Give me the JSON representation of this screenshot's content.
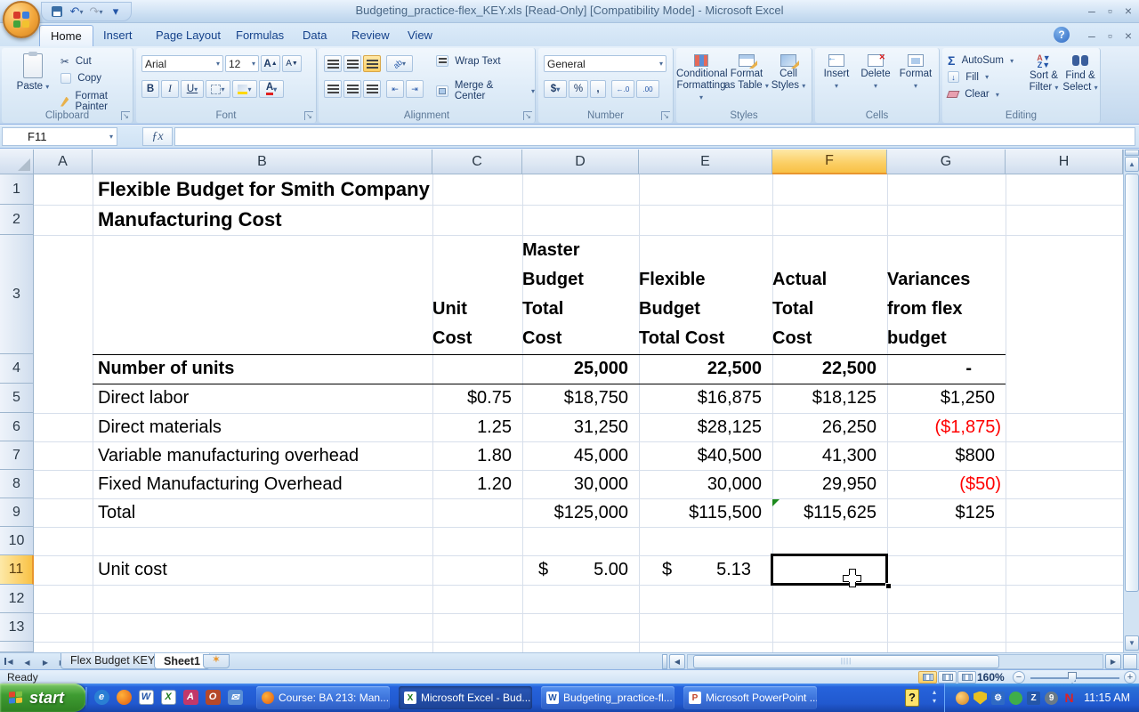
{
  "window": {
    "title": "Budgeting_practice-flex_KEY.xls  [Read-Only]  [Compatibility Mode] -  Microsoft Excel",
    "minimize": "–",
    "restore": "▫",
    "close": "×",
    "help": "?"
  },
  "ribbon": {
    "tabs": [
      {
        "label": "Home"
      },
      {
        "label": "Insert"
      },
      {
        "label": "Page Layout"
      },
      {
        "label": "Formulas"
      },
      {
        "label": "Data"
      },
      {
        "label": "Review"
      },
      {
        "label": "View"
      }
    ],
    "clipboard": {
      "label": "Clipboard",
      "paste": "Paste",
      "cut": "Cut",
      "copy": "Copy",
      "format_painter": "Format Painter"
    },
    "font": {
      "label": "Font",
      "name": "Arial",
      "size": "12",
      "bold": "B",
      "italic": "I",
      "underline": "U",
      "grow": "A",
      "shrink": "A"
    },
    "alignment": {
      "label": "Alignment",
      "wrap": "Wrap Text",
      "merge": "Merge & Center"
    },
    "number": {
      "label": "Number",
      "format": "General",
      "currency": "$",
      "percent": "%",
      "comma": ",",
      "inc_dec": "←.0",
      "dec_dec": ".00"
    },
    "styles": {
      "label": "Styles",
      "conditional1": "Conditional",
      "conditional2": "Formatting",
      "as_table1": "Format",
      "as_table2": "as Table",
      "cell1": "Cell",
      "cell2": "Styles"
    },
    "cells": {
      "label": "Cells",
      "insert": "Insert",
      "delete": "Delete",
      "format": "Format"
    },
    "editing": {
      "label": "Editing",
      "autosum": "AutoSum",
      "fill": "Fill",
      "clear": "Clear",
      "sort1": "Sort &",
      "sort2": "Filter",
      "find1": "Find &",
      "find2": "Select"
    }
  },
  "formula_bar": {
    "name_box": "F11",
    "fx": "ƒx",
    "formula": ""
  },
  "grid": {
    "columns": [
      "A",
      "B",
      "C",
      "D",
      "E",
      "F",
      "G",
      "H"
    ],
    "rows": [
      "1",
      "2",
      "3",
      "4",
      "5",
      "6",
      "7",
      "8",
      "9",
      "10",
      "11",
      "12",
      "13"
    ],
    "selected_cell": "F11"
  },
  "sheet": {
    "title_line1": "Flexible Budget for Smith Company",
    "title_line2": "Manufacturing Cost",
    "col_headers": {
      "unit_cost": "Unit\nCost",
      "master_budget": "Master\nBudget\nTotal\nCost",
      "flexible_budget": "Flexible\nBudget\nTotal Cost",
      "actual": "Actual\nTotal\nCost",
      "variances": "Variances\nfrom flex\nbudget"
    },
    "rows": [
      {
        "label": "Number of units",
        "d": "25,000",
        "e": "22,500",
        "f": "22,500",
        "g": "-"
      },
      {
        "label": "Direct labor",
        "c": "$0.75",
        "d": "$18,750",
        "e": "$16,875",
        "f": "$18,125",
        "g": "$1,250"
      },
      {
        "label": "Direct materials",
        "c": "1.25",
        "d": "31,250",
        "e": "$28,125",
        "f": "26,250",
        "g": "($1,875)"
      },
      {
        "label": "Variable manufacturing overhead",
        "c": "1.80",
        "d": "45,000",
        "e": "$40,500",
        "f": "41,300",
        "g": "$800"
      },
      {
        "label": "Fixed Manufacturing Overhead",
        "c": "1.20",
        "d": "30,000",
        "e": "30,000",
        "f": "29,950",
        "g": "($50)"
      },
      {
        "label": "Total",
        "d": "$125,000",
        "e": "$115,500",
        "f": "$115,625",
        "g": "$125"
      }
    ],
    "unit_cost": {
      "label": "Unit cost",
      "d_sym": "$",
      "d_val": "5.00",
      "e_sym": "$",
      "e_val": "5.13"
    }
  },
  "sheet_tabs": {
    "tabs": [
      {
        "label": "Flex Budget KEY"
      },
      {
        "label": "Sheet1"
      }
    ]
  },
  "status_bar": {
    "mode": "Ready",
    "zoom_level": "160%"
  },
  "taskbar": {
    "start": "start",
    "buttons": [
      {
        "label": "Course: BA 213: Man..."
      },
      {
        "label": "Microsoft Excel - Bud..."
      },
      {
        "label": "Budgeting_practice-fl..."
      },
      {
        "label": "Microsoft PowerPoint ..."
      }
    ],
    "clock": "11:15 AM"
  }
}
